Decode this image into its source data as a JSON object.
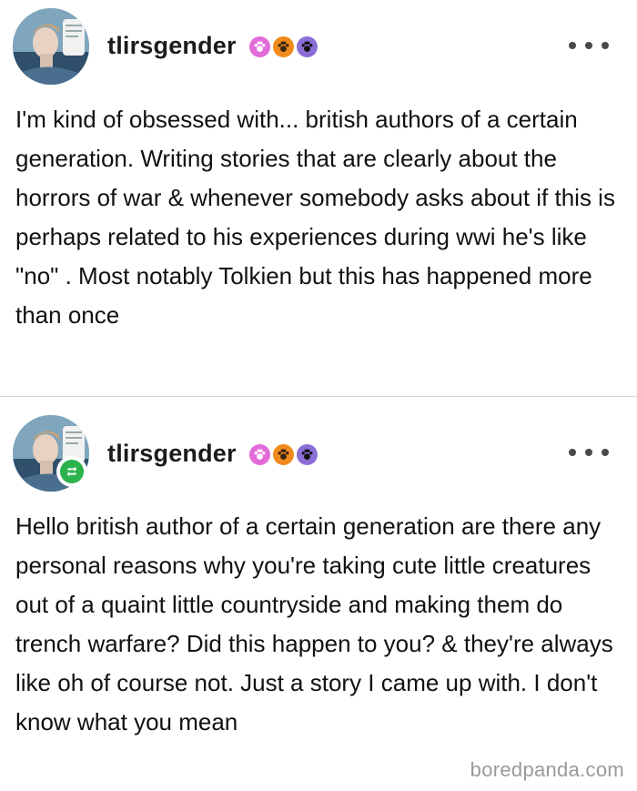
{
  "posts": [
    {
      "username": "tlirsgender",
      "badges": [
        "pink-paw-badge-icon",
        "orange-paw-badge-icon",
        "purple-paw-badge-icon"
      ],
      "body": "I'm kind of obsessed with... british authors of a certain generation. Writing stories that are clearly about the horrors of war & whenever somebody asks about if this is perhaps related to his experiences during wwi he's like \"no\" . Most notably Tolkien but this has happened more than once"
    },
    {
      "username": "tlirsgender",
      "reblogged": true,
      "badges": [
        "pink-paw-badge-icon",
        "orange-paw-badge-icon",
        "purple-paw-badge-icon"
      ],
      "body": "Hello british author of a certain generation are there any personal reasons why you're taking cute little creatures out of a quaint little countryside and making them do trench warfare? Did this happen to you? & they're always like oh of course not. Just a story I came up with. I don't know what you mean"
    }
  ],
  "watermark": "boredpanda.com",
  "colors": {
    "reblog_green": "#2bb24c",
    "badge_pink": "#e26bd8",
    "badge_orange": "#f08a1c",
    "badge_purple": "#8b6fd6",
    "divider": "#d6d6d6"
  }
}
